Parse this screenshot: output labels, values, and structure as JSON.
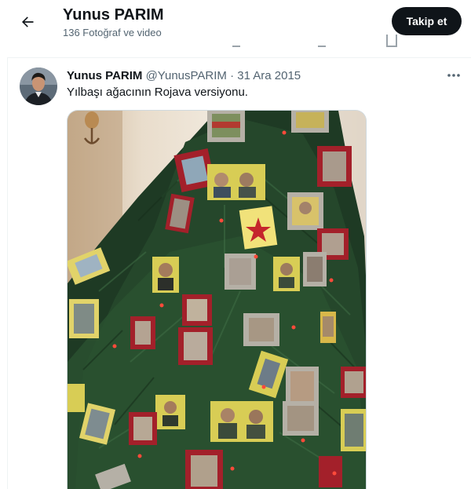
{
  "header": {
    "title": "Yunus PARIM",
    "subtitle": "136 Fotoğraf ve video",
    "back_icon": "arrow-left-icon",
    "follow_label": "Takip et"
  },
  "tweet": {
    "display_name": "Yunus PARIM",
    "handle": "@YunusPARIM",
    "separator": "·",
    "date": "31 Ara 2015",
    "text": "Yılbaşı ağacının Rojava versiyonu.",
    "more_icon": "more-horizontal-icon"
  },
  "media": {
    "description_icon": "photo",
    "frame_colors": [
      "#a3202a",
      "#b5b0a6"
    ]
  }
}
